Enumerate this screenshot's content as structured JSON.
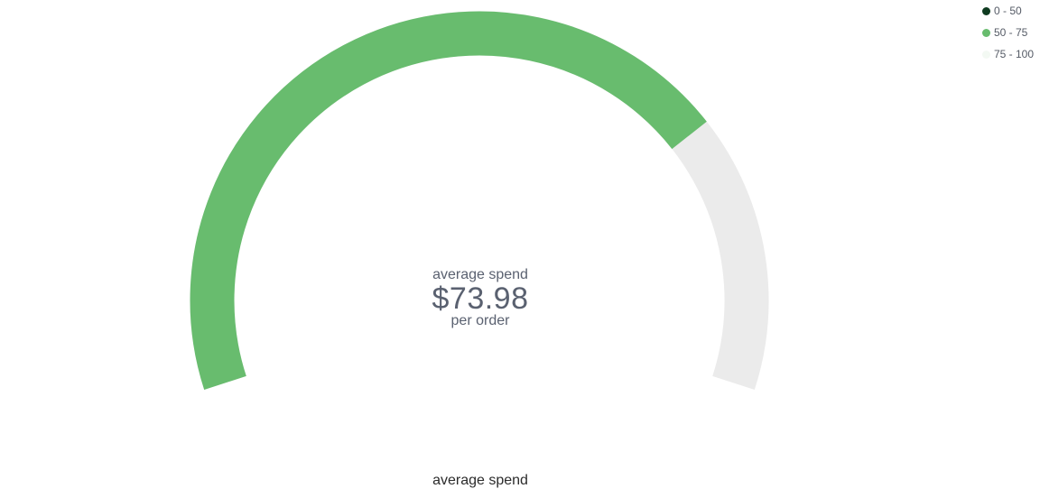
{
  "chart_data": {
    "type": "gauge",
    "value": 73.98,
    "range": [
      0,
      100
    ],
    "label_top": "average spend",
    "value_label": "$73.98",
    "label_bottom": "per order",
    "title": "average spend",
    "track_color": "#ebebeb",
    "bands": [
      {
        "label": "0 - 50",
        "from": 0,
        "to": 50,
        "color": "#0f3b20"
      },
      {
        "label": "50 - 75",
        "from": 50,
        "to": 75,
        "color": "#68bc6e"
      },
      {
        "label": "75 - 100",
        "from": 75,
        "to": 100,
        "color": "#f3f9f3"
      }
    ],
    "fill_color": "#68bc6e",
    "legend_position": "top-right"
  }
}
